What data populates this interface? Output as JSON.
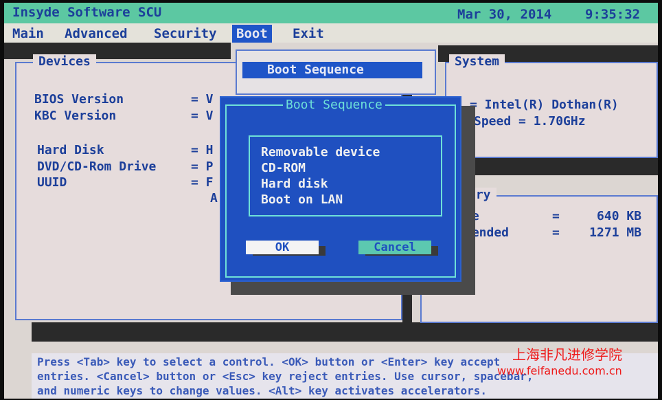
{
  "title_bar": {
    "app": "Insyde Software SCU",
    "date": "Mar 30, 2014",
    "time": "9:35:32"
  },
  "menu": [
    "Main",
    "Advanced",
    "Security",
    "Boot",
    "Exit"
  ],
  "menu_selected": "Boot",
  "devices": {
    "title": "Devices",
    "rows": [
      {
        "label": "BIOS Version",
        "value": "= V"
      },
      {
        "label": "KBC Version",
        "value": "= V"
      },
      {
        "label": "Hard Disk",
        "value": "= H"
      },
      {
        "label": "DVD/CD-Rom Drive",
        "value": "= P"
      },
      {
        "label": "UUID",
        "value": "= F"
      },
      {
        "label": "",
        "value": "A"
      }
    ]
  },
  "system": {
    "title": "System",
    "line1": "= Intel(R) Dothan(R)",
    "line2": "Speed = 1.70GHz"
  },
  "memory": {
    "title": "ory",
    "rows": [
      {
        "label": "se",
        "value": "=     640 KB"
      },
      {
        "label": "tended",
        "value": "=    1271 MB"
      }
    ]
  },
  "boot_submenu": {
    "selected": "Boot Sequence"
  },
  "dialog": {
    "title": "Boot Sequence",
    "items": [
      "Removable device",
      "CD-ROM",
      "Hard disk",
      "Boot on LAN"
    ],
    "ok": "OK",
    "cancel": "Cancel"
  },
  "status": [
    "Press <Tab> key to select a control. <OK> button or <Enter> key accept",
    "entries. <Cancel> button or <Esc> key reject entries. Use cursor, spacebar,",
    "and numeric keys to change values. <Alt> key activates accelerators."
  ],
  "watermark": {
    "line1": "上海非凡进修学院",
    "line2": "www.feifanedu.com.cn"
  },
  "colors": {
    "title_bar": "#5cc8a2",
    "dialog": "#1f50c0",
    "accent": "#6ee0d8",
    "text": "#1c3f9a"
  }
}
